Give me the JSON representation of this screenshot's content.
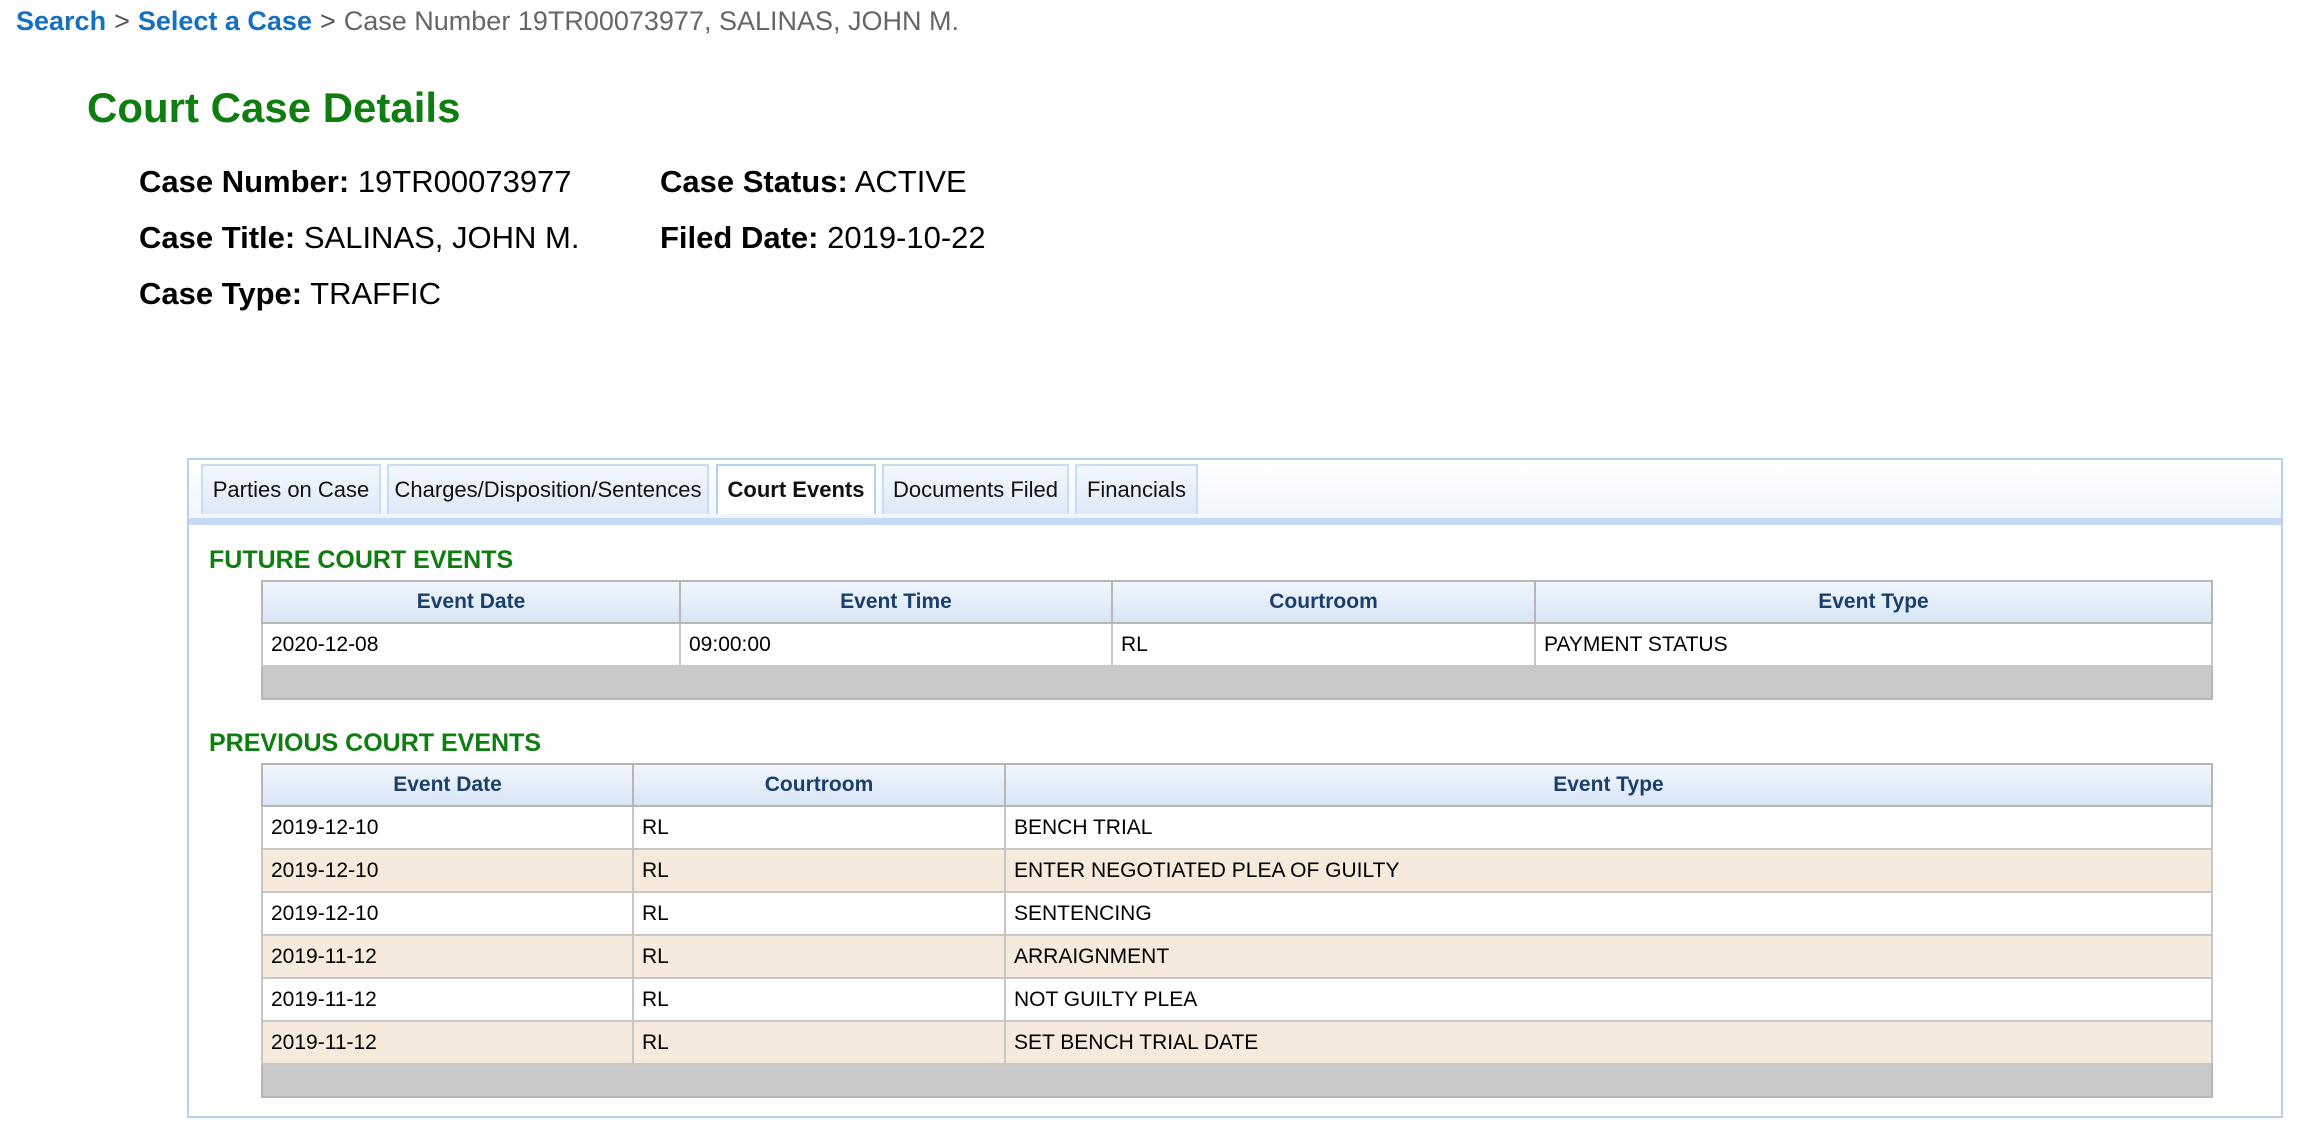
{
  "breadcrumb": {
    "search": "Search",
    "sep1": ">",
    "select_case": "Select a Case",
    "sep2": ">",
    "current": "Case Number 19TR00073977, SALINAS, JOHN M."
  },
  "page_title": "Court Case Details",
  "case_info": {
    "number_label": "Case Number:",
    "number_value": "19TR00073977",
    "title_label": "Case Title:",
    "title_value": "SALINAS, JOHN M.",
    "type_label": "Case Type:",
    "type_value": "TRAFFIC",
    "status_label": "Case Status:",
    "status_value": "ACTIVE",
    "filed_label": "Filed Date:",
    "filed_value": "2019-10-22"
  },
  "tabs": [
    {
      "label": "Parties on Case",
      "active": false
    },
    {
      "label": "Charges/Disposition/Sentences",
      "active": false
    },
    {
      "label": "Court Events",
      "active": true
    },
    {
      "label": "Documents Filed",
      "active": false
    },
    {
      "label": "Financials",
      "active": false
    }
  ],
  "future_events": {
    "title": "FUTURE COURT EVENTS",
    "columns": [
      "Event Date",
      "Event Time",
      "Courtroom",
      "Event Type"
    ],
    "rows": [
      [
        "2020-12-08",
        "09:00:00",
        "RL",
        "PAYMENT STATUS"
      ]
    ]
  },
  "previous_events": {
    "title": "PREVIOUS COURT EVENTS",
    "columns": [
      "Event Date",
      "Courtroom",
      "Event Type"
    ],
    "rows": [
      [
        "2019-12-10",
        "RL",
        "BENCH TRIAL"
      ],
      [
        "2019-12-10",
        "RL",
        "ENTER NEGOTIATED PLEA OF GUILTY"
      ],
      [
        "2019-12-10",
        "RL",
        "SENTENCING"
      ],
      [
        "2019-11-12",
        "RL",
        "ARRAIGNMENT"
      ],
      [
        "2019-11-12",
        "RL",
        "NOT GUILTY PLEA"
      ],
      [
        "2019-11-12",
        "RL",
        "SET BENCH TRIAL DATE"
      ]
    ]
  },
  "colors": {
    "title_green": "#0f7d0f",
    "link_blue": "#1571c0",
    "header_text": "#1b3f6b",
    "alt_row": "#f5eadb",
    "footer_row": "#c9c9c9"
  }
}
